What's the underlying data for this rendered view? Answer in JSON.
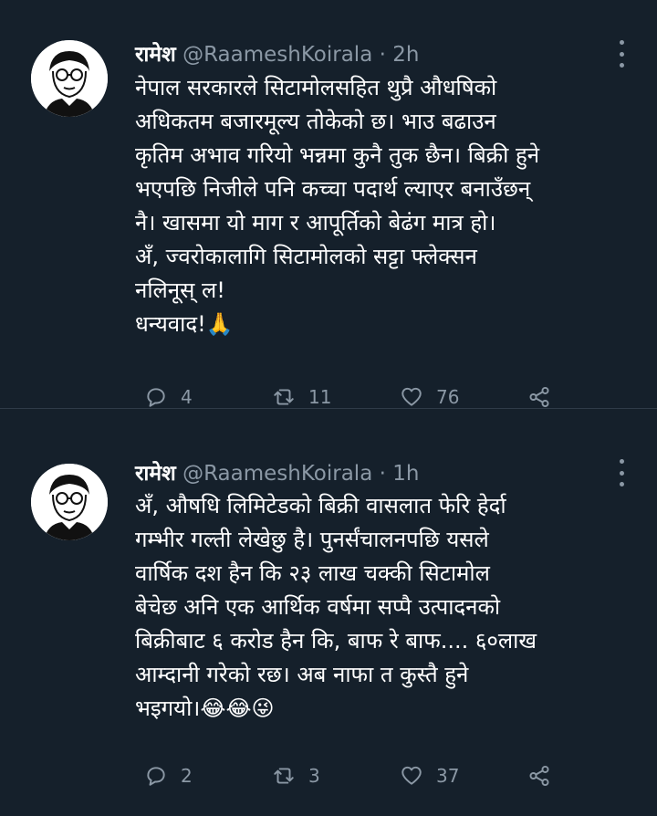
{
  "tweets": [
    {
      "name": "रामेश",
      "handle": "@RaameshKoirala",
      "separator": "·",
      "time": "2h",
      "text": "नेपाल सरकारले सिटामोलसहित थुप्रै औधषिको\nअधिकतम बजारमूल्य तोकेको छ। भाउ बढाउन\nकृतिम अभाव गरियो भन्नमा कुनै तुक छैन। बिक्री हुने\nभएपछि निजीले पनि कच्चा पदार्थ ल्याएर बनाउँछन्\nनै। खासमा यो माग र आपूर्तिको बेढंग मात्र हो।\nअँ, ज्वरोकालागि सिटामोलको सट्टा फ्लेक्सन\nनलिनूस् ल!\nधन्यवाद!🙏",
      "replies": "4",
      "retweets": "11",
      "likes": "76"
    },
    {
      "name": "रामेश",
      "handle": "@RaameshKoirala",
      "separator": "·",
      "time": "1h",
      "text": "अँ, औषधि लिमिटेडको बिक्री वासलात फेरि हेर्दा\nगम्भीर गल्ती लेखेछु है। पुनर्संचालनपछि यसले\nवार्षिक दश हैन कि २३ लाख चक्की सिटामोल\nबेचेछ अनि एक आर्थिक वर्षमा सप्पै उत्पादनको\nबिक्रीबाट ६ करोड हैन कि, बाफ रे बाफ.... ६०लाख\nआम्दानी गरेको रछ। अब नाफा त कुस्तै हुने\nभइगयो।😂😂😜",
      "replies": "2",
      "retweets": "3",
      "likes": "37"
    }
  ],
  "icons": [
    "avatar-sketch",
    "more-icon",
    "reply-icon",
    "retweet-icon",
    "like-icon",
    "share-icon"
  ],
  "colors": {
    "background": "#15202b",
    "text": "#ffffff",
    "muted": "#8b98a5"
  }
}
